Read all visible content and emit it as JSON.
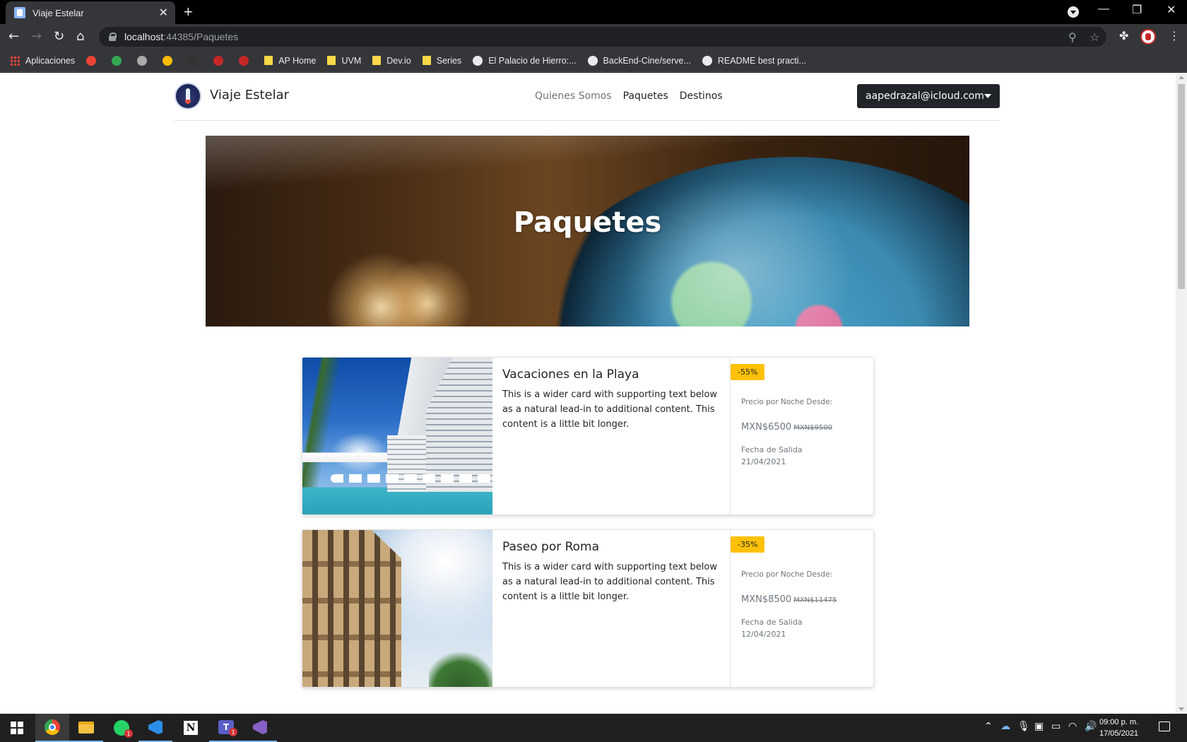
{
  "browser": {
    "tab_title": "Viaje Estelar",
    "tab_close": "✕",
    "new_tab": "+",
    "url_host": "localhost",
    "url_path": ":44385/Paquetes",
    "window_controls": {
      "minimize": "—",
      "restore": "❐",
      "close": "✕"
    },
    "bookmarks": [
      {
        "label": "Aplicaciones",
        "icon": "apps-grid-icon"
      },
      {
        "label": "",
        "icon": "gmail-icon",
        "color": "#ea4335"
      },
      {
        "label": "",
        "icon": "drive-icon",
        "color": "#34a853"
      },
      {
        "label": "",
        "icon": "apple-icon",
        "color": "#aaaaaa"
      },
      {
        "label": "",
        "icon": "pinwheel-icon",
        "color": "#fbbc05"
      },
      {
        "label": "",
        "icon": "github-dark-icon",
        "color": "#333333"
      },
      {
        "label": "",
        "icon": "speedometer-icon",
        "color": "#c62828"
      },
      {
        "label": "",
        "icon": "nfl-icon",
        "color": "#c62828"
      },
      {
        "label": "AP Home",
        "icon": "folder-icon"
      },
      {
        "label": "UVM",
        "icon": "folder-icon"
      },
      {
        "label": "Dev.io",
        "icon": "folder-icon"
      },
      {
        "label": "Series",
        "icon": "folder-icon"
      },
      {
        "label": "El Palacio de Hierro:...",
        "icon": "palacio-icon"
      },
      {
        "label": "BackEnd-Cine/serve...",
        "icon": "github-icon"
      },
      {
        "label": "README best practi...",
        "icon": "medium-icon"
      }
    ]
  },
  "site": {
    "brand": "Viaje Estelar",
    "nav": [
      {
        "label": "Quienes Somos",
        "color": "#6c757d"
      },
      {
        "label": "Paquetes",
        "color": "#212529"
      },
      {
        "label": "Destinos",
        "color": "#212529"
      }
    ],
    "user_email": "aapedrazal@icloud.com",
    "hero_title": "Paquetes"
  },
  "packages": [
    {
      "title": "Vacaciones en la Playa",
      "description": "This is a wider card with supporting text below as a natural lead-in to additional content. This content is a little bit longer.",
      "discount": "-55%",
      "price_label": "Precio por Noche Desde:",
      "price": "MXN$6500",
      "old_price": "MXN$9500",
      "date_label": "Fecha de Salida",
      "date": "21/04/2021"
    },
    {
      "title": "Paseo por Roma",
      "description": "This is a wider card with supporting text below as a natural lead-in to additional content. This content is a little bit longer.",
      "discount": "-35%",
      "price_label": "Precio por Noche Desde:",
      "price": "MXN$8500",
      "old_price": "MXN$11475",
      "date_label": "Fecha de Salida",
      "date": "12/04/2021"
    }
  ],
  "taskbar": {
    "clock_time": "09:00 p. m.",
    "clock_date": "17/05/2021",
    "whatsapp_badge": "1",
    "teams_badge": "1",
    "teams_letter": "T",
    "notion_letter": "N"
  },
  "colors": {
    "accent_badge": "#ffc107",
    "user_button": "#212529"
  }
}
